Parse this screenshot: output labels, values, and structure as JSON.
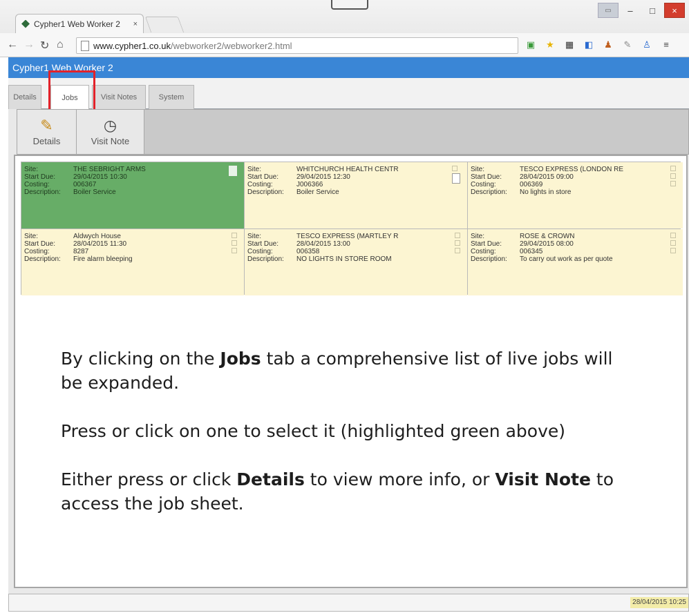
{
  "browser": {
    "tab_title": "Cypher1 Web Worker 2",
    "tab_close": "×",
    "url_host": "www.cypher1.co.uk",
    "url_path": "/webworker2/webworker2.html",
    "win_min": "–",
    "win_max": "□",
    "win_close": "×"
  },
  "app": {
    "title": "Cypher1 Web Worker 2",
    "tabs": [
      {
        "label": "Details"
      },
      {
        "label": "Jobs"
      },
      {
        "label": "Visit Notes"
      },
      {
        "label": "System"
      }
    ],
    "actions": {
      "details_label": "Details",
      "visit_note_label": "Visit Note"
    },
    "field_labels": {
      "site": "Site:",
      "start_due": "Start Due:",
      "costing": "Costing:",
      "description": "Description:"
    },
    "jobs": [
      {
        "site": "THE SEBRIGHT ARMS",
        "start_due": "29/04/2015 10:30",
        "costing": "006367",
        "description": "Boiler Service",
        "selected": true
      },
      {
        "site": "WHITCHURCH HEALTH CENTR",
        "start_due": "29/04/2015 12:30",
        "costing": "J006366",
        "description": "Boiler Service",
        "selected": false
      },
      {
        "site": "TESCO EXPRESS (LONDON RE",
        "start_due": "28/04/2015 09:00",
        "costing": "006369",
        "description": "No lights in store",
        "selected": false
      },
      {
        "site": "Aldwych House",
        "start_due": "28/04/2015 11:30",
        "costing": "8287",
        "description": "Fire alarm bleeping",
        "selected": false
      },
      {
        "site": "TESCO EXPRESS (MARTLEY R",
        "start_due": "28/04/2015 13:00",
        "costing": "006358",
        "description": "NO LIGHTS IN STORE ROOM",
        "selected": false
      },
      {
        "site": "ROSE & CROWN",
        "start_due": "29/04/2015 08:00",
        "costing": "006345",
        "description": "To carry out work as per quote",
        "selected": false
      }
    ],
    "status_time": "28/04/2015 10:25"
  },
  "instructions": {
    "p1_before": "By clicking on the ",
    "p1_bold": "Jobs",
    "p1_after": " tab a comprehensive list of live jobs will be expanded.",
    "p2": "Press or click on one to select it (highlighted green above)",
    "p3_before": "Either press or click ",
    "p3_bold1": "Details",
    "p3_middle": " to view more info, or ",
    "p3_bold2": "Visit Note",
    "p3_after": " to access the job sheet."
  },
  "colors": {
    "title_bar": "#3a86d6",
    "selected_job": "#67ad67",
    "job_card": "#fcf5d2",
    "highlight_box": "#e2222a"
  }
}
